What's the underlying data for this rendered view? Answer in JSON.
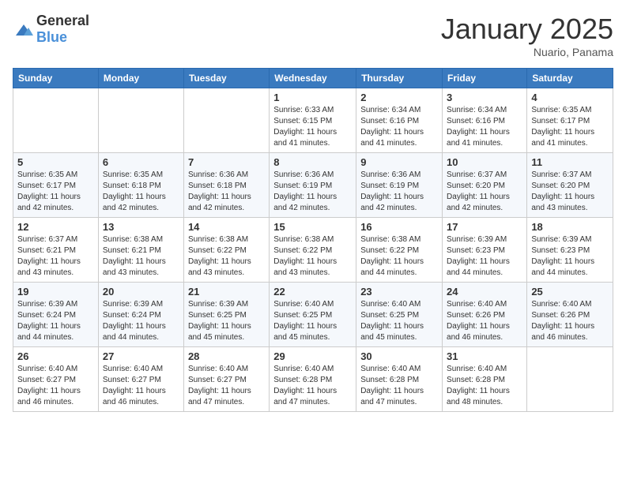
{
  "header": {
    "logo": {
      "general": "General",
      "blue": "Blue"
    },
    "title": "January 2025",
    "location": "Nuario, Panama"
  },
  "weekdays": [
    "Sunday",
    "Monday",
    "Tuesday",
    "Wednesday",
    "Thursday",
    "Friday",
    "Saturday"
  ],
  "weeks": [
    [
      {
        "day": "",
        "info": ""
      },
      {
        "day": "",
        "info": ""
      },
      {
        "day": "",
        "info": ""
      },
      {
        "day": "1",
        "info": "Sunrise: 6:33 AM\nSunset: 6:15 PM\nDaylight: 11 hours and 41 minutes."
      },
      {
        "day": "2",
        "info": "Sunrise: 6:34 AM\nSunset: 6:16 PM\nDaylight: 11 hours and 41 minutes."
      },
      {
        "day": "3",
        "info": "Sunrise: 6:34 AM\nSunset: 6:16 PM\nDaylight: 11 hours and 41 minutes."
      },
      {
        "day": "4",
        "info": "Sunrise: 6:35 AM\nSunset: 6:17 PM\nDaylight: 11 hours and 41 minutes."
      }
    ],
    [
      {
        "day": "5",
        "info": "Sunrise: 6:35 AM\nSunset: 6:17 PM\nDaylight: 11 hours and 42 minutes."
      },
      {
        "day": "6",
        "info": "Sunrise: 6:35 AM\nSunset: 6:18 PM\nDaylight: 11 hours and 42 minutes."
      },
      {
        "day": "7",
        "info": "Sunrise: 6:36 AM\nSunset: 6:18 PM\nDaylight: 11 hours and 42 minutes."
      },
      {
        "day": "8",
        "info": "Sunrise: 6:36 AM\nSunset: 6:19 PM\nDaylight: 11 hours and 42 minutes."
      },
      {
        "day": "9",
        "info": "Sunrise: 6:36 AM\nSunset: 6:19 PM\nDaylight: 11 hours and 42 minutes."
      },
      {
        "day": "10",
        "info": "Sunrise: 6:37 AM\nSunset: 6:20 PM\nDaylight: 11 hours and 42 minutes."
      },
      {
        "day": "11",
        "info": "Sunrise: 6:37 AM\nSunset: 6:20 PM\nDaylight: 11 hours and 43 minutes."
      }
    ],
    [
      {
        "day": "12",
        "info": "Sunrise: 6:37 AM\nSunset: 6:21 PM\nDaylight: 11 hours and 43 minutes."
      },
      {
        "day": "13",
        "info": "Sunrise: 6:38 AM\nSunset: 6:21 PM\nDaylight: 11 hours and 43 minutes."
      },
      {
        "day": "14",
        "info": "Sunrise: 6:38 AM\nSunset: 6:22 PM\nDaylight: 11 hours and 43 minutes."
      },
      {
        "day": "15",
        "info": "Sunrise: 6:38 AM\nSunset: 6:22 PM\nDaylight: 11 hours and 43 minutes."
      },
      {
        "day": "16",
        "info": "Sunrise: 6:38 AM\nSunset: 6:22 PM\nDaylight: 11 hours and 44 minutes."
      },
      {
        "day": "17",
        "info": "Sunrise: 6:39 AM\nSunset: 6:23 PM\nDaylight: 11 hours and 44 minutes."
      },
      {
        "day": "18",
        "info": "Sunrise: 6:39 AM\nSunset: 6:23 PM\nDaylight: 11 hours and 44 minutes."
      }
    ],
    [
      {
        "day": "19",
        "info": "Sunrise: 6:39 AM\nSunset: 6:24 PM\nDaylight: 11 hours and 44 minutes."
      },
      {
        "day": "20",
        "info": "Sunrise: 6:39 AM\nSunset: 6:24 PM\nDaylight: 11 hours and 44 minutes."
      },
      {
        "day": "21",
        "info": "Sunrise: 6:39 AM\nSunset: 6:25 PM\nDaylight: 11 hours and 45 minutes."
      },
      {
        "day": "22",
        "info": "Sunrise: 6:40 AM\nSunset: 6:25 PM\nDaylight: 11 hours and 45 minutes."
      },
      {
        "day": "23",
        "info": "Sunrise: 6:40 AM\nSunset: 6:25 PM\nDaylight: 11 hours and 45 minutes."
      },
      {
        "day": "24",
        "info": "Sunrise: 6:40 AM\nSunset: 6:26 PM\nDaylight: 11 hours and 46 minutes."
      },
      {
        "day": "25",
        "info": "Sunrise: 6:40 AM\nSunset: 6:26 PM\nDaylight: 11 hours and 46 minutes."
      }
    ],
    [
      {
        "day": "26",
        "info": "Sunrise: 6:40 AM\nSunset: 6:27 PM\nDaylight: 11 hours and 46 minutes."
      },
      {
        "day": "27",
        "info": "Sunrise: 6:40 AM\nSunset: 6:27 PM\nDaylight: 11 hours and 46 minutes."
      },
      {
        "day": "28",
        "info": "Sunrise: 6:40 AM\nSunset: 6:27 PM\nDaylight: 11 hours and 47 minutes."
      },
      {
        "day": "29",
        "info": "Sunrise: 6:40 AM\nSunset: 6:28 PM\nDaylight: 11 hours and 47 minutes."
      },
      {
        "day": "30",
        "info": "Sunrise: 6:40 AM\nSunset: 6:28 PM\nDaylight: 11 hours and 47 minutes."
      },
      {
        "day": "31",
        "info": "Sunrise: 6:40 AM\nSunset: 6:28 PM\nDaylight: 11 hours and 48 minutes."
      },
      {
        "day": "",
        "info": ""
      }
    ]
  ]
}
